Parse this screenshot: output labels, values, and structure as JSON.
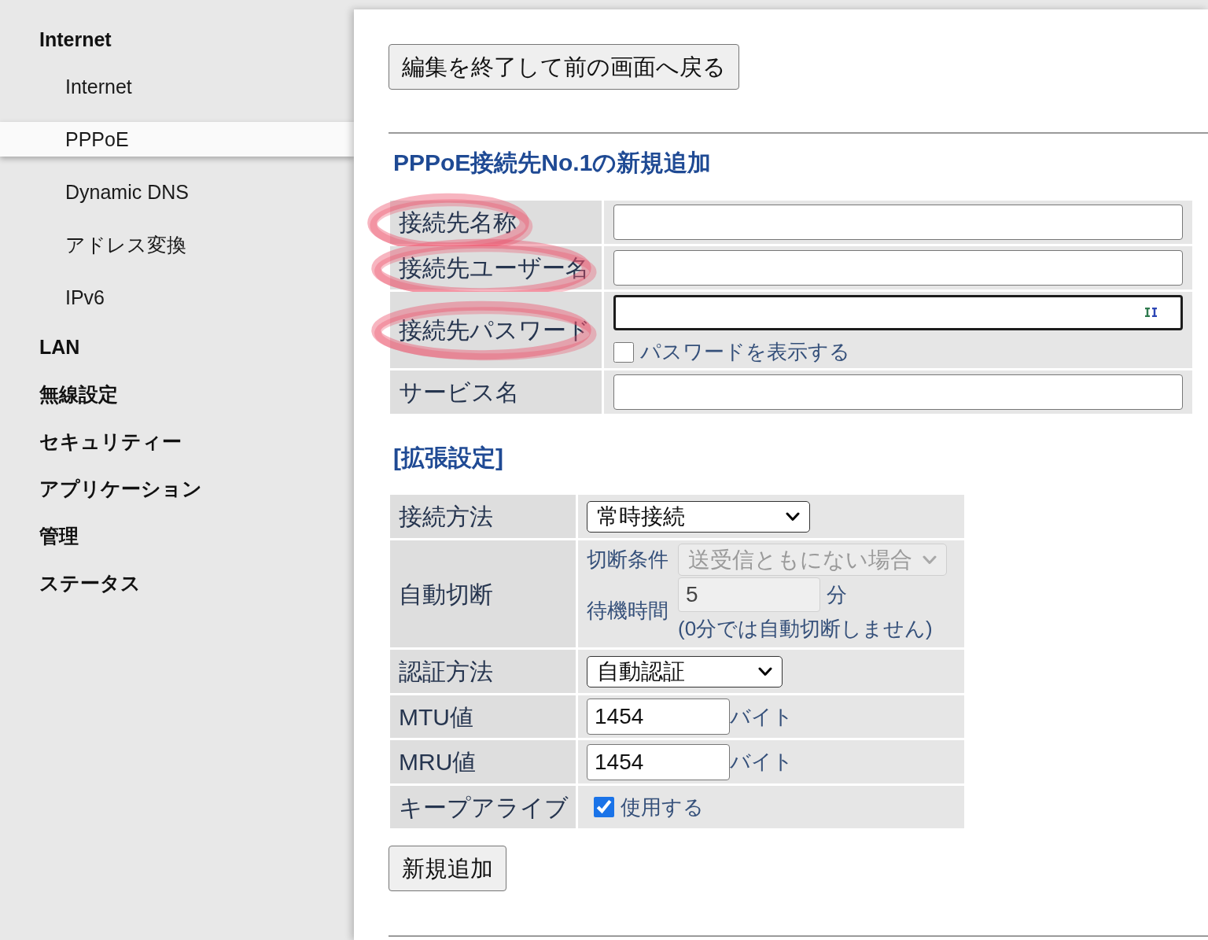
{
  "sidebar": {
    "items": [
      {
        "label": "Internet",
        "selected": false,
        "children": [
          {
            "label": "Internet",
            "selected": false
          },
          {
            "label": "PPPoE",
            "selected": true
          },
          {
            "label": "Dynamic DNS",
            "selected": false
          },
          {
            "label": "アドレス変換",
            "selected": false
          },
          {
            "label": "IPv6",
            "selected": false
          }
        ]
      },
      {
        "label": "LAN",
        "selected": false
      },
      {
        "label": "無線設定",
        "selected": false
      },
      {
        "label": "セキュリティー",
        "selected": false
      },
      {
        "label": "アプリケーション",
        "selected": false
      },
      {
        "label": "管理",
        "selected": false
      },
      {
        "label": "ステータス",
        "selected": false
      }
    ]
  },
  "back_button": {
    "label": "編集を終了して前の画面へ戻る"
  },
  "form": {
    "title": "PPPoE接続先No.1の新規追加",
    "fields": [
      {
        "label": "接続先名称",
        "kind": "text",
        "highlighted": true,
        "focused": false
      },
      {
        "label": "接続先ユーザー名",
        "kind": "text",
        "highlighted": true,
        "focused": false
      },
      {
        "label": "接続先パスワード",
        "kind": "password",
        "highlighted": true,
        "focused": true,
        "show_password": {
          "label": "パスワードを表示する",
          "checked": false
        }
      },
      {
        "label": "サービス名",
        "kind": "text",
        "highlighted": false,
        "focused": false
      }
    ]
  },
  "extended": {
    "title": "[拡張設定]",
    "fields": [
      {
        "label": "接続方法",
        "kind": "select",
        "value": "常時接続"
      },
      {
        "label": "自動切断",
        "kind": "auto_disconnect",
        "condition": {
          "label": "切断条件",
          "value": "送受信ともにない場合",
          "disabled": true
        },
        "wait": {
          "label": "待機時間",
          "value": "5",
          "unit": "分",
          "disabled": true
        },
        "note": "(0分では自動切断しません)"
      },
      {
        "label": "認証方法",
        "kind": "select",
        "value": "自動認証"
      },
      {
        "label": "MTU値",
        "kind": "number",
        "value": "1454",
        "unit": "バイト"
      },
      {
        "label": "MRU値",
        "kind": "number",
        "value": "1454",
        "unit": "バイト"
      },
      {
        "label": "キープアライブ",
        "kind": "checkbox",
        "option": "使用する",
        "checked": true
      }
    ]
  },
  "submit_button": {
    "label": "新規追加"
  }
}
